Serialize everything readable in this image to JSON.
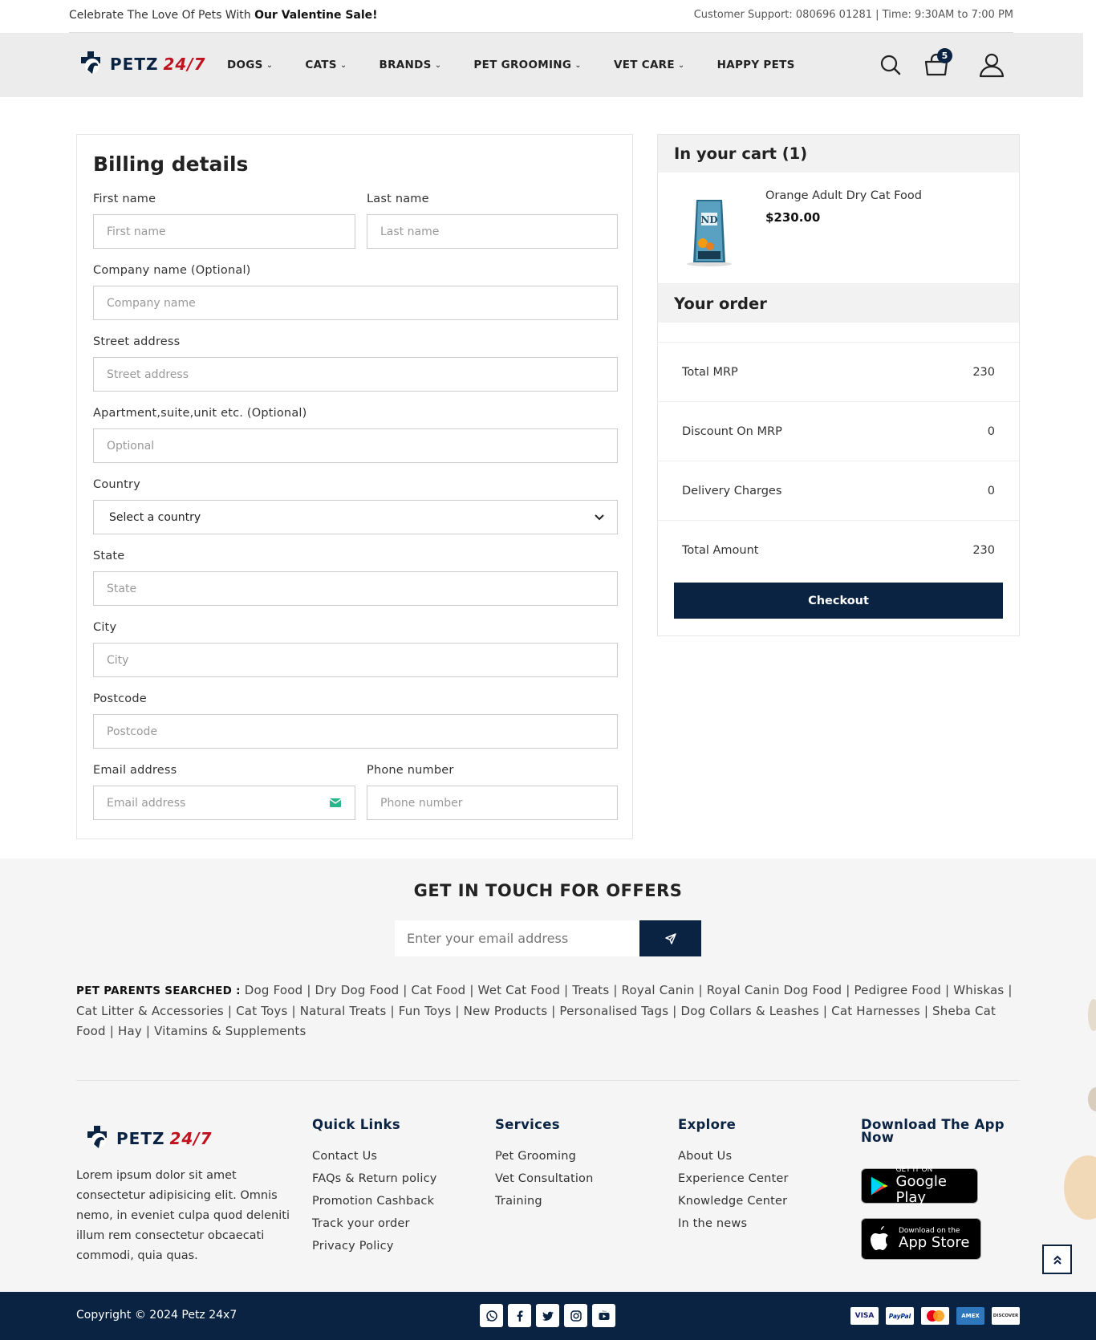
{
  "topbar": {
    "promo_text": "Celebrate The Love Of Pets With",
    "promo_bold": "Our Valentine Sale!",
    "support": "Customer Support: 080696 01281 | Time: 9:30AM to 7:00 PM"
  },
  "brand": {
    "name_a": "PETZ",
    "name_b": "24/7"
  },
  "nav": {
    "items": [
      {
        "label": "DOGS",
        "dropdown": true
      },
      {
        "label": "CATS",
        "dropdown": true
      },
      {
        "label": "BRANDS",
        "dropdown": true
      },
      {
        "label": "PET GROOMING",
        "dropdown": true
      },
      {
        "label": "VET CARE",
        "dropdown": true
      },
      {
        "label": "HAPPY PETS",
        "dropdown": false
      }
    ],
    "cart_count": "5"
  },
  "billing": {
    "title": "Billing details",
    "first_name": {
      "label": "First name",
      "placeholder": "First name"
    },
    "last_name": {
      "label": "Last name",
      "placeholder": "Last name"
    },
    "company": {
      "label": "Company name (Optional)",
      "placeholder": "Company name"
    },
    "street": {
      "label": "Street address",
      "placeholder": "Street address"
    },
    "apartment": {
      "label": "Apartment,suite,unit etc. (Optional)",
      "placeholder": "Optional"
    },
    "country": {
      "label": "Country",
      "value": "Select a country"
    },
    "state": {
      "label": "State",
      "placeholder": "State"
    },
    "city": {
      "label": "City",
      "placeholder": "City"
    },
    "postcode": {
      "label": "Postcode",
      "placeholder": "Postcode"
    },
    "email": {
      "label": "Email address",
      "placeholder": "Email address"
    },
    "phone": {
      "label": "Phone number",
      "placeholder": "Phone number"
    }
  },
  "cart": {
    "title": "In your cart (1)",
    "item_name": "Orange Adult Dry Cat Food",
    "item_price": "$230.00",
    "order_title": "Your order",
    "rows": [
      {
        "label": "Total MRP",
        "value": "230"
      },
      {
        "label": "Discount On MRP",
        "value": "0"
      },
      {
        "label": "Delivery Charges",
        "value": "0"
      },
      {
        "label": "Total Amount",
        "value": "230"
      }
    ],
    "checkout_label": "Checkout"
  },
  "offers": {
    "title": "GET IN TOUCH FOR OFFERS",
    "email_placeholder": "Enter your email address"
  },
  "searched": {
    "label": "PET PARENTS SEARCHED :",
    "terms": "Dog Food | Dry Dog Food | Cat Food | Wet Cat Food | Treats | Royal Canin | Royal Canin Dog Food | Pedigree Food | Whiskas | Cat Litter & Accessories | Cat Toys | Natural Treats | Fun Toys | New Products | Personalised Tags | Dog Collars & Leashes | Cat Harnesses | Sheba Cat Food | Hay | Vitamins & Supplements"
  },
  "footer": {
    "about": "Lorem ipsum dolor sit amet consectetur adipisicing elit. Omnis nemo, in eveniet culpa quod deleniti illum rem consectetur obcaecati commodi, quia quas.",
    "quick_links": {
      "title": "Quick Links",
      "items": [
        "Contact Us",
        "FAQs & Return policy",
        "Promotion Cashback",
        "Track your order",
        "Privacy Policy"
      ]
    },
    "services": {
      "title": "Services",
      "items": [
        "Pet Grooming",
        "Vet Consultation",
        "Training"
      ]
    },
    "explore": {
      "title": "Explore",
      "items": [
        "About Us",
        "Experience Center",
        "Knowledge Center",
        "In the news"
      ]
    },
    "app": {
      "title_1": "Download The App",
      "title_2": "Now",
      "google_small": "GET IT ON",
      "google_big": "Google Play",
      "apple_small": "Download on the",
      "apple_big": "App Store"
    },
    "copyright": "Copyright © 2024 Petz 24x7",
    "cards": [
      "VISA",
      "PayPal",
      "",
      "AMEX",
      "DISCOVER"
    ]
  },
  "colors": {
    "primary": "#0a2342",
    "accent": "#c1121f"
  }
}
